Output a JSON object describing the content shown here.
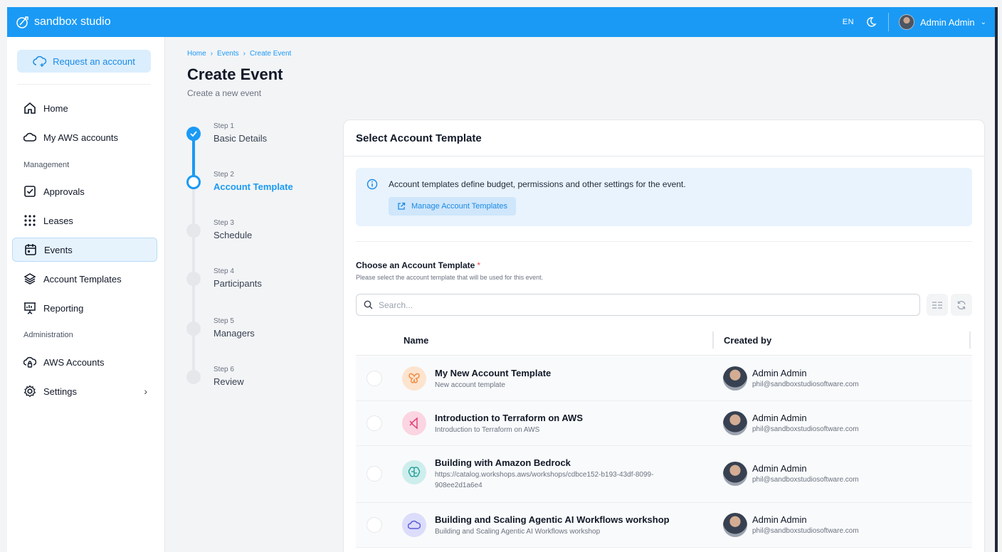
{
  "topbar": {
    "brand": "sandbox studio",
    "lang": "EN",
    "user_name": "Admin Admin"
  },
  "sidebar": {
    "request_button": "Request an account",
    "items": [
      {
        "label": "Home",
        "icon": "home-icon"
      },
      {
        "label": "My AWS accounts",
        "icon": "cloud-icon"
      },
      {
        "label": "Approvals",
        "icon": "check-square-icon"
      },
      {
        "label": "Leases",
        "icon": "grid-dots-icon"
      },
      {
        "label": "Events",
        "icon": "calendar-icon"
      },
      {
        "label": "Account Templates",
        "icon": "layers-icon"
      },
      {
        "label": "Reporting",
        "icon": "presentation-icon"
      },
      {
        "label": "AWS Accounts",
        "icon": "cloud-lock-icon"
      },
      {
        "label": "Settings",
        "icon": "gear-icon"
      }
    ],
    "sections": [
      "Management",
      "Administration"
    ]
  },
  "header": {
    "breadcrumb": [
      "Home",
      "Events",
      "Create Event"
    ],
    "title": "Create Event",
    "subtitle": "Create a new event"
  },
  "steps": [
    {
      "num": "Step 1",
      "name": "Basic Details",
      "state": "done"
    },
    {
      "num": "Step 2",
      "name": "Account Template",
      "state": "current"
    },
    {
      "num": "Step 3",
      "name": "Schedule",
      "state": "pending"
    },
    {
      "num": "Step 4",
      "name": "Participants",
      "state": "pending"
    },
    {
      "num": "Step 5",
      "name": "Managers",
      "state": "pending"
    },
    {
      "num": "Step 6",
      "name": "Review",
      "state": "pending"
    }
  ],
  "card": {
    "title": "Select Account Template",
    "info_text": "Account templates define budget, permissions and other settings for the event.",
    "manage_button": "Manage Account Templates",
    "choose_label": "Choose an Account Template",
    "required_mark": "*",
    "choose_help": "Please select the account template that will be used for this event.",
    "search_placeholder": "Search...",
    "columns": [
      "Name",
      "Created by"
    ]
  },
  "templates": [
    {
      "name": "My New Account Template",
      "desc": "New account template",
      "icon": "butterfly-icon",
      "icon_bg": "#fde4cf",
      "icon_color": "#f08a3c",
      "creator": "Admin Admin",
      "email": "phil@sandboxstudiosoftware.com"
    },
    {
      "name": "Introduction to Terraform on AWS",
      "desc": "Introduction to Terraform on AWS",
      "icon": "code-icon",
      "icon_bg": "#fbd5e1",
      "icon_color": "#e0447a",
      "creator": "Admin Admin",
      "email": "phil@sandboxstudiosoftware.com"
    },
    {
      "name": "Building with Amazon Bedrock",
      "desc": "https://catalog.workshops.aws/workshops/cdbce152-b193-43df-8099-908ee2d1a6e4",
      "icon": "brain-icon",
      "icon_bg": "#cdeeed",
      "icon_color": "#1c9a94",
      "creator": "Admin Admin",
      "email": "phil@sandboxstudiosoftware.com"
    },
    {
      "name": "Building and Scaling Agentic AI Workflows workshop",
      "desc": "Building and Scaling Agentic AI Workflows workshop",
      "icon": "cloud-icon",
      "icon_bg": "#dcdcfb",
      "icon_color": "#5b5bd6",
      "creator": "Admin Admin",
      "email": "phil@sandboxstudiosoftware.com"
    }
  ]
}
